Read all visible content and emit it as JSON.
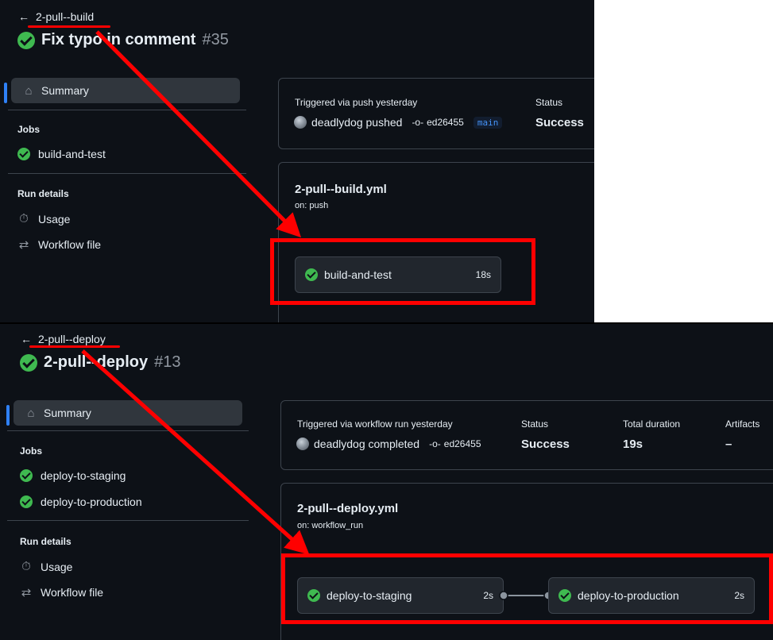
{
  "top": {
    "back_link": "2-pull--build",
    "title": "Fix typo in comment",
    "run_number": "#35",
    "summary_label": "Summary",
    "jobs_heading": "Jobs",
    "jobs": [
      "build-and-test"
    ],
    "run_details_heading": "Run details",
    "usage_label": "Usage",
    "workflow_file_label": "Workflow file",
    "trigger_label": "Triggered via push yesterday",
    "actor": "deadlydog pushed",
    "commit": "ed26455",
    "branch": "main",
    "status_label": "Status",
    "status_value": "Success",
    "workflow_name": "2-pull--build.yml",
    "workflow_on": "on: push",
    "graph_jobs": [
      {
        "name": "build-and-test",
        "duration": "18s"
      }
    ]
  },
  "bottom": {
    "back_link": "2-pull--deploy",
    "title": "2-pull--deploy",
    "run_number": "#13",
    "summary_label": "Summary",
    "jobs_heading": "Jobs",
    "jobs": [
      "deploy-to-staging",
      "deploy-to-production"
    ],
    "run_details_heading": "Run details",
    "usage_label": "Usage",
    "workflow_file_label": "Workflow file",
    "trigger_label": "Triggered via workflow run yesterday",
    "actor": "deadlydog completed",
    "commit": "ed26455",
    "status_label": "Status",
    "status_value": "Success",
    "duration_label": "Total duration",
    "duration_value": "19s",
    "artifacts_label": "Artifacts",
    "artifacts_value": "–",
    "workflow_name": "2-pull--deploy.yml",
    "workflow_on": "on: workflow_run",
    "graph_jobs": [
      {
        "name": "deploy-to-staging",
        "duration": "2s"
      },
      {
        "name": "deploy-to-production",
        "duration": "2s"
      }
    ]
  },
  "colors": {
    "background": "#0d1117",
    "success": "#3fb950",
    "annotation": "#ff0000",
    "accent": "#2f81f7"
  },
  "icons": [
    "arrow-left-icon",
    "check-circle-icon",
    "home-icon",
    "stopwatch-icon",
    "workflow-file-icon",
    "git-commit-icon"
  ]
}
